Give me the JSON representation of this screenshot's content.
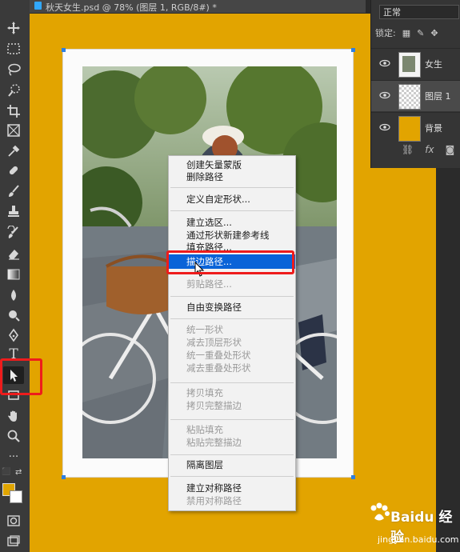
{
  "document_tab": {
    "title": "秋天女生.psd @ 78% (图层 1, RGB/8#) *"
  },
  "toolbar": {
    "tools": [
      "move-tool",
      "marquee-tool",
      "lasso-tool",
      "quick-select-tool",
      "crop-tool",
      "frame-tool",
      "eyedropper-tool",
      "healing-brush-tool",
      "brush-tool",
      "clone-stamp-tool",
      "history-brush-tool",
      "eraser-tool",
      "gradient-tool",
      "blur-tool",
      "dodge-tool",
      "pen-tool",
      "type-tool",
      "path-selection-tool",
      "rectangle-tool",
      "hand-tool",
      "zoom-tool",
      "more-tools"
    ],
    "foreground_color": "#e0a500",
    "background_color": "#ffffff",
    "selected_tool": "path-selection-tool"
  },
  "layers_panel": {
    "blend_mode": "正常",
    "lock_label": "锁定:",
    "layers": [
      {
        "name": "女生",
        "visible": true,
        "selected": false
      },
      {
        "name": "图层 1",
        "visible": true,
        "selected": true
      },
      {
        "name": "背景",
        "visible": true,
        "selected": false
      }
    ],
    "fx_label": "fx"
  },
  "canvas": {
    "background_color": "#e2a400",
    "frame_color": "#fbfbfb"
  },
  "context_menu": {
    "groups": [
      [
        {
          "label": "创建矢量蒙版",
          "enabled": true
        },
        {
          "label": "删除路径",
          "enabled": true
        }
      ],
      [
        {
          "label": "定义自定形状...",
          "enabled": true
        }
      ],
      [
        {
          "label": "建立选区...",
          "enabled": true
        },
        {
          "label": "通过形状新建参考线",
          "enabled": true
        },
        {
          "label": "填充路径...",
          "enabled": true
        },
        {
          "label": "描边路径...",
          "enabled": true,
          "highlighted": true
        },
        {
          "label": "剪贴路径...",
          "enabled": false
        }
      ],
      [
        {
          "label": "自由变换路径",
          "enabled": true
        }
      ],
      [
        {
          "label": "统一形状",
          "enabled": false
        },
        {
          "label": "减去顶层形状",
          "enabled": false
        },
        {
          "label": "统一重叠处形状",
          "enabled": false
        },
        {
          "label": "减去重叠处形状",
          "enabled": false
        }
      ],
      [
        {
          "label": "拷贝填充",
          "enabled": false
        },
        {
          "label": "拷贝完整描边",
          "enabled": false
        }
      ],
      [
        {
          "label": "粘贴填充",
          "enabled": false
        },
        {
          "label": "粘贴完整描边",
          "enabled": false
        }
      ],
      [
        {
          "label": "隔离图层",
          "enabled": true
        }
      ],
      [
        {
          "label": "建立对称路径",
          "enabled": true
        },
        {
          "label": "禁用对称路径",
          "enabled": false
        }
      ]
    ]
  },
  "watermark": {
    "text": "Baidu 经验",
    "url": "jingyan.baidu.com"
  }
}
